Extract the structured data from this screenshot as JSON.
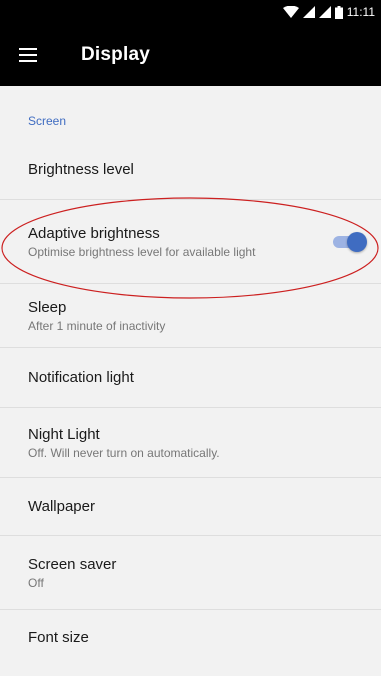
{
  "status_bar": {
    "time": "11:11"
  },
  "app_bar": {
    "title": "Display",
    "menu_icon": "menu-icon"
  },
  "section": {
    "header": "Screen"
  },
  "settings": {
    "brightness": {
      "title": "Brightness level"
    },
    "adaptive": {
      "title": "Adaptive brightness",
      "summary": "Optimise brightness level for available light",
      "enabled": true
    },
    "sleep": {
      "title": "Sleep",
      "summary": "After 1 minute of inactivity"
    },
    "notification_light": {
      "title": "Notification light"
    },
    "night_light": {
      "title": "Night Light",
      "summary": "Off. Will never turn on automatically."
    },
    "wallpaper": {
      "title": "Wallpaper"
    },
    "screen_saver": {
      "title": "Screen saver",
      "summary": "Off"
    },
    "font_size": {
      "title": "Font size"
    }
  },
  "colors": {
    "accent": "#3f6cc1",
    "annotation": "#cc2020",
    "bar": "#000000"
  }
}
